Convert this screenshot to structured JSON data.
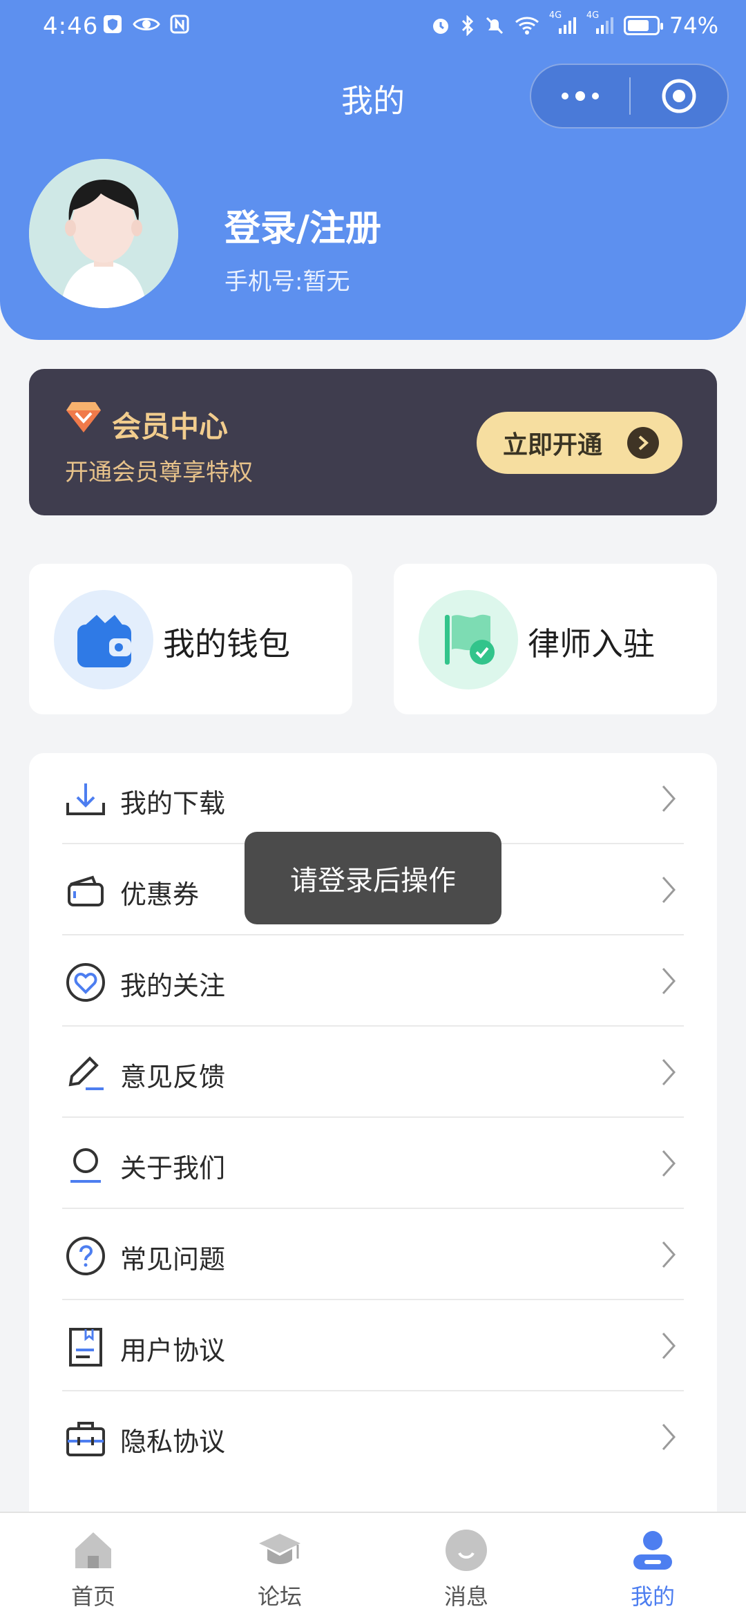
{
  "status_bar": {
    "time": "4:46",
    "network_1": "4G",
    "network_2": "4G",
    "battery": "74%",
    "battery_level": 0.74
  },
  "header": {
    "title": "我的"
  },
  "profile": {
    "name": "登录/注册",
    "phone": "手机号:暂无"
  },
  "member": {
    "title": "会员中心",
    "subtitle": "开通会员尊享特权",
    "button": "立即开通"
  },
  "quick": [
    {
      "label": "我的钱包",
      "icon": "wallet-icon"
    },
    {
      "label": "律师入驻",
      "icon": "flag-check-icon"
    }
  ],
  "menu": [
    {
      "label": "我的下载",
      "icon": "download-icon"
    },
    {
      "label": "优惠券",
      "icon": "coupon-icon"
    },
    {
      "label": "我的关注",
      "icon": "heart-icon"
    },
    {
      "label": "意见反馈",
      "icon": "edit-icon"
    },
    {
      "label": "关于我们",
      "icon": "user-circle-icon"
    },
    {
      "label": "常见问题",
      "icon": "question-icon"
    },
    {
      "label": "用户协议",
      "icon": "document-icon"
    },
    {
      "label": "隐私协议",
      "icon": "briefcase-icon"
    }
  ],
  "toast": "请登录后操作",
  "tabs": [
    {
      "label": "首页",
      "icon": "home-icon"
    },
    {
      "label": "论坛",
      "icon": "graduation-cap-icon"
    },
    {
      "label": "消息",
      "icon": "chat-face-icon"
    },
    {
      "label": "我的",
      "icon": "profile-icon",
      "active": true
    }
  ],
  "colors": {
    "primary": "#5d90ef",
    "member_bg": "#3f3d4e",
    "member_gold": "#f2cd8e",
    "active_tab": "#4d7ef0"
  }
}
